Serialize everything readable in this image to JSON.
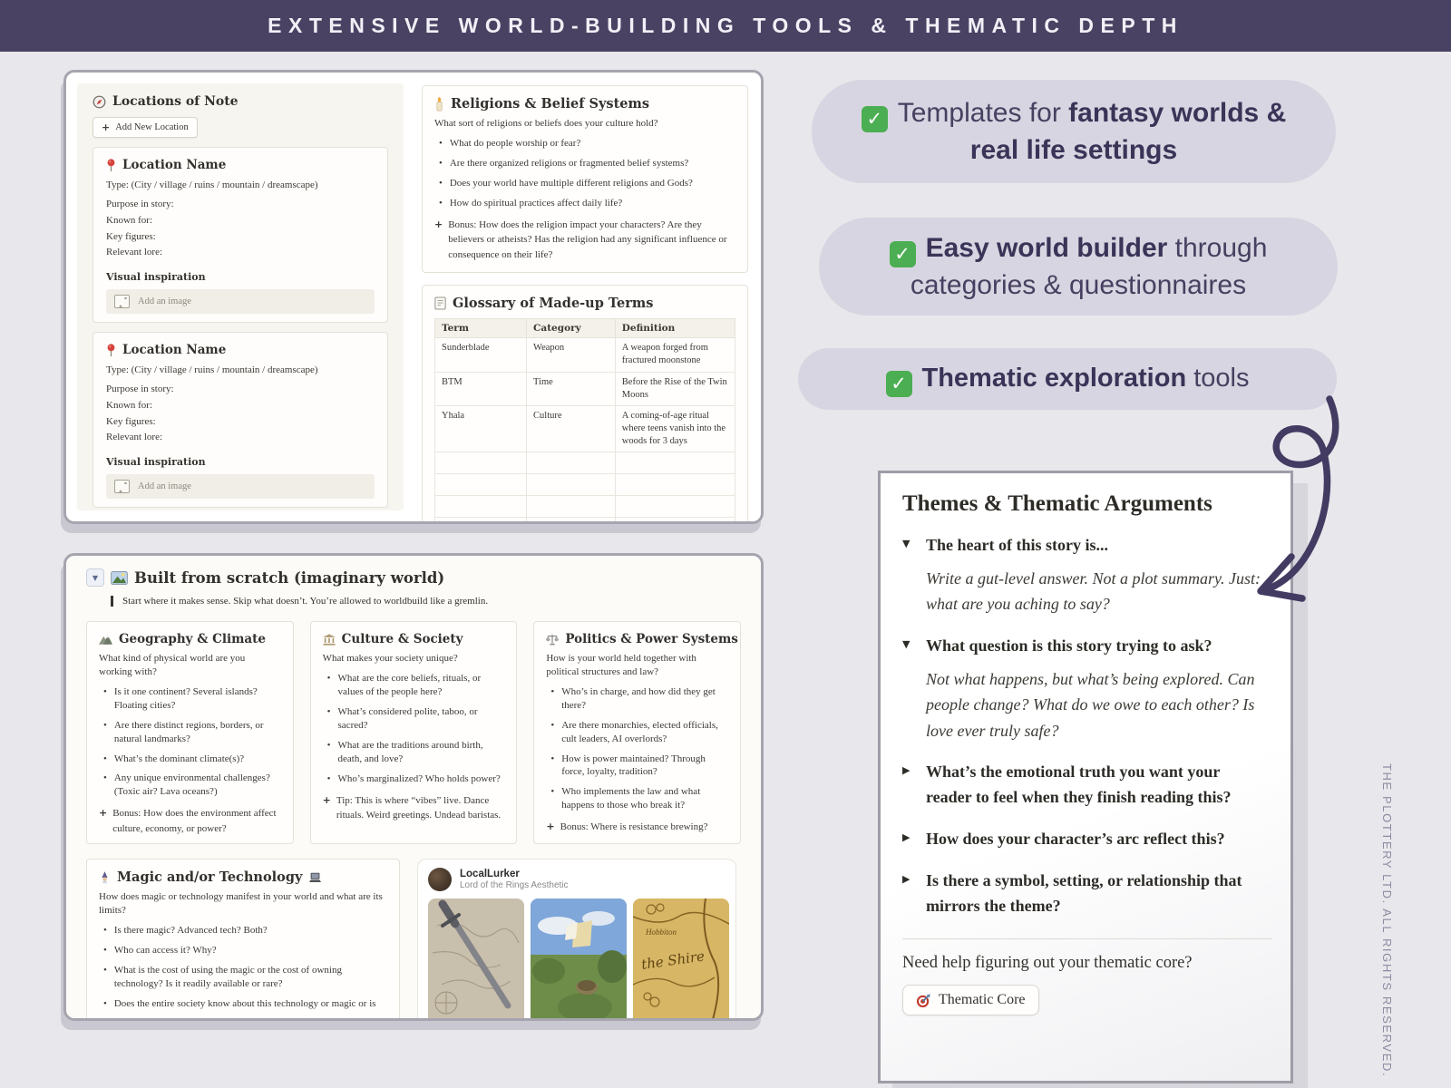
{
  "banner": {
    "text": "EXTENSIVE WORLD-BUILDING TOOLS & THEMATIC DEPTH"
  },
  "chars": {
    "bullet": "•",
    "plus": "+",
    "toggle_down": "▼",
    "toggle_right": "▶",
    "check": "✓"
  },
  "locations": {
    "title": "Locations of Note",
    "add_button": "Add New Location",
    "card": {
      "title": "Location Name",
      "type_line": "Type: (City / village / ruins / mountain / dreamscape)",
      "fields": [
        "Purpose in story:",
        "Known for:",
        "Key figures:",
        "Relevant lore:"
      ],
      "visual_heading": "Visual inspiration",
      "add_image": "Add an image"
    }
  },
  "religions": {
    "title": "Religions & Belief Systems",
    "intro": "What sort of religions or beliefs does your culture hold?",
    "bullets": [
      "What do people worship or fear?",
      "Are there organized religions or fragmented belief systems?",
      "Does your world have multiple different religions and Gods?",
      "How do spiritual practices affect daily life?"
    ],
    "bonus": "Bonus: How does the religion impact your characters? Are they believers or atheists? Has the religion had any significant influence or consequence on their life?"
  },
  "glossary": {
    "title": "Glossary of Made-up Terms",
    "headers": [
      "Term",
      "Category",
      "Definition"
    ],
    "rows": [
      {
        "term": "Sunderblade",
        "category": "Weapon",
        "definition": "A weapon forged from fractured moonstone"
      },
      {
        "term": "BTM",
        "category": "Time",
        "definition": "Before the Rise of the Twin Moons"
      },
      {
        "term": "Yhala",
        "category": "Culture",
        "definition": "A coming-of-age ritual where teens vanish into the woods for 3 days"
      }
    ]
  },
  "built": {
    "title": "Built from scratch (imaginary world)",
    "quote": "Start where it makes sense. Skip what doesn’t. You’re allowed to worldbuild like a gremlin.",
    "columns": [
      {
        "title": "Geography & Climate",
        "intro": "What kind of physical world are you working with?",
        "bullets": [
          "Is it one continent? Several islands? Floating cities?",
          "Are there distinct regions, borders, or natural landmarks?",
          "What’s the dominant climate(s)?",
          "Any unique environmental challenges? (Toxic air? Lava oceans?)"
        ],
        "bonus": "Bonus: How does the environment affect culture, economy, or power?"
      },
      {
        "title": "Culture & Society",
        "intro": "What makes your society unique?",
        "bullets": [
          "What are the core beliefs, rituals, or values of the people here?",
          "What’s considered polite, taboo, or sacred?",
          "What are the traditions around birth, death, and love?",
          "Who’s marginalized? Who holds power?"
        ],
        "bonus": "Tip: This is where “vibes” live. Dance rituals. Weird greetings. Undead baristas."
      },
      {
        "title": "Politics & Power Systems",
        "intro": "How is your world held together with political structures and law?",
        "bullets": [
          "Who’s in charge, and how did they get there?",
          "Are there monarchies, elected officials, cult leaders, AI overlords?",
          "How is power maintained? Through force, loyalty, tradition?",
          "Who implements the law and what happens to those who break it?"
        ],
        "bonus": "Bonus: Where is resistance brewing?"
      }
    ],
    "magic": {
      "title": "Magic and/or Technology",
      "intro": "How does magic or technology manifest in your world and what are its limits?",
      "bullets": [
        "Is there magic? Advanced tech? Both?",
        "Who can access it? Why?",
        "What is the cost of using the magic or the cost of owning technology? Is it readily available or rare?",
        "Does the entire society know about this technology or magic or is"
      ]
    },
    "embed": {
      "username": "LocalLurker",
      "subtitle": "Lord of the Rings Aesthetic",
      "map_label": "the Shire",
      "map_label2": "Hobbiton"
    }
  },
  "badges": [
    {
      "pre": "Templates for ",
      "bold": "fantasy worlds & real life settings",
      "post": ""
    },
    {
      "pre": "",
      "bold": "Easy world builder",
      "post": " through categories & questionnaires"
    },
    {
      "pre": "",
      "bold": "Thematic exploration",
      "post": " tools"
    }
  ],
  "themes": {
    "title": "Themes & Thematic Arguments",
    "items": [
      {
        "q": "The heart of this story is...",
        "a": "Write a gut-level answer. Not a plot summary. Just: what are you aching to say?"
      },
      {
        "q": "What question is this story trying to ask?",
        "a": "Not what happens, but what’s being explored. Can people change? What do we owe to each other? Is love ever truly safe?"
      },
      {
        "q": "What’s the emotional truth you want your reader to feel when they finish reading this?"
      },
      {
        "q": "How does your character’s arc reflect this?"
      },
      {
        "q": "Is there a symbol, setting, or relationship that mirrors the theme?"
      }
    ],
    "footer_question": "Need help figuring out your thematic core?",
    "button": "Thematic Core"
  },
  "watermark": "THE PLOTTERY LTD. ALL RIGHTS RESERVED."
}
